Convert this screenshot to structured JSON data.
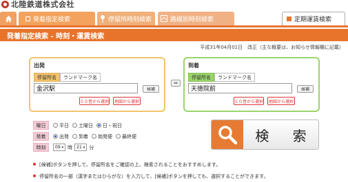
{
  "header": {
    "logo_text": "北陸鉄道株式会社"
  },
  "tabs": {
    "home_icon": "home-icon",
    "main": "発着指定検索",
    "stop": "停留所時刻検索",
    "route": "路線別時刻検索",
    "pass": "定期運賃検索"
  },
  "section": {
    "title": "発着指定検索 - 時刻・運賃検索"
  },
  "notice": "平成31年04月01日　改正（主な概要は、お知らせ情報欄に記載）",
  "departure": {
    "title": "出発",
    "mode_stop": "停留所名",
    "mode_landmark": "ランドマーク名",
    "station": "金沢駅",
    "candidate_btn": "候補",
    "select_kana": "５０音から選択",
    "select_map": "地図から選択"
  },
  "arrival": {
    "title": "到着",
    "mode_stop": "停留所名",
    "mode_landmark": "ランドマーク名",
    "station": "天徳院前",
    "candidate_btn": "候補",
    "select_kana": "５０音から選択",
    "select_map": "地図から選択"
  },
  "swap_btn": "⇔",
  "options": {
    "day_label": "曜日",
    "day_weekday": "平日",
    "day_saturday": "土曜日",
    "day_holiday": "日・祝日",
    "type_label": "発着",
    "type_depart": "出発",
    "type_arrive": "到着",
    "type_first": "始発便",
    "type_last": "最終便",
    "time_label": "時刻",
    "hour": "09",
    "hour_unit": "時",
    "minute": "21",
    "minute_unit": "分"
  },
  "search": {
    "label": "検 索"
  },
  "notes": [
    "[候補]ボタンを押して、停留所名をご確認の上、検索されることをおすすめします。",
    "停留所名の一部（漢字またはひらがな）を入力して、[候補]ボタンを押しても、選択することができます。"
  ],
  "colors": {
    "accent": "#e8742c",
    "departure_border": "#f1c36b",
    "arrival_border": "#9ad46c"
  }
}
